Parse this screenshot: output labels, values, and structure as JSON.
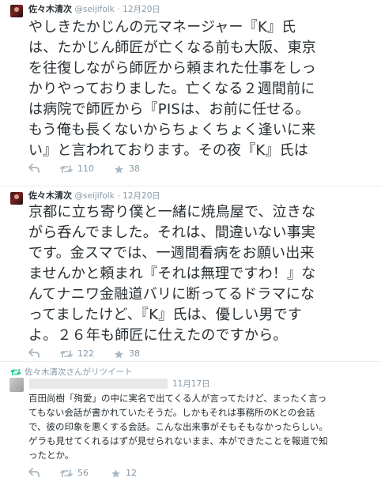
{
  "tweets": [
    {
      "name": "佐々木清次",
      "handle": "@seijifolk",
      "dot": "·",
      "date": "12月20日",
      "lines": [
        "やしきたかじんの元マネージャー『K』氏",
        "は、たかじん師匠が亡くなる前も大阪、東京",
        "を往復しながら師匠から頼まれた仕事をしっ",
        "かりやっておりました。亡くなる２週間前に",
        "は病院で師匠から『PISは、お前に任せる。",
        "もう俺も長くないからちょくちょく逢いに来",
        "い』と言われております。その夜『K』氏は"
      ],
      "actions": {
        "reply_icon": "reply-icon",
        "retweet_icon": "retweet-icon",
        "retweets": "110",
        "favorite_icon": "star-icon",
        "favorites": "38"
      }
    },
    {
      "name": "佐々木清次",
      "handle": "@seijifolk",
      "dot": "·",
      "date": "12月20日",
      "lines": [
        "京都に立ち寄り僕と一緒に焼鳥屋で、泣きな",
        "がら呑んでました。それは、間違いない事実",
        "です。金スマでは、一週間看病をお願い出来",
        "ませんかと頼まれ『それは無理ですわ！』な",
        "んてナニワ金融道バリに断ってるドラマにな",
        "ってましたけど、『K』氏は、優しい男です",
        "よ。２６年も師匠に仕えたのですから。"
      ],
      "actions": {
        "reply_icon": "reply-icon",
        "retweet_icon": "retweet-icon",
        "retweets": "122",
        "favorite_icon": "star-icon",
        "favorites": "38"
      }
    },
    {
      "retweet_label": "佐々木清次さんがリツイート",
      "date": "11月17日",
      "lines": [
        "百田尚樹「殉愛」の中に実名で出てくる人が言ってたけど、まったく言っ",
        "てもない会話が書かれていたそうだ。しかもそれは事務所のKとの会話",
        "で、彼の印象を悪くする会話。こんな出来事がそもそもなかったらしい。",
        "ゲラも見せてくれるはずが見せられないまま、本ができたことを報道で知",
        "ったとか。"
      ],
      "actions": {
        "reply_icon": "reply-icon",
        "retweet_icon": "retweet-icon",
        "retweets": "56",
        "favorite_icon": "star-icon",
        "favorites": "12"
      }
    }
  ]
}
